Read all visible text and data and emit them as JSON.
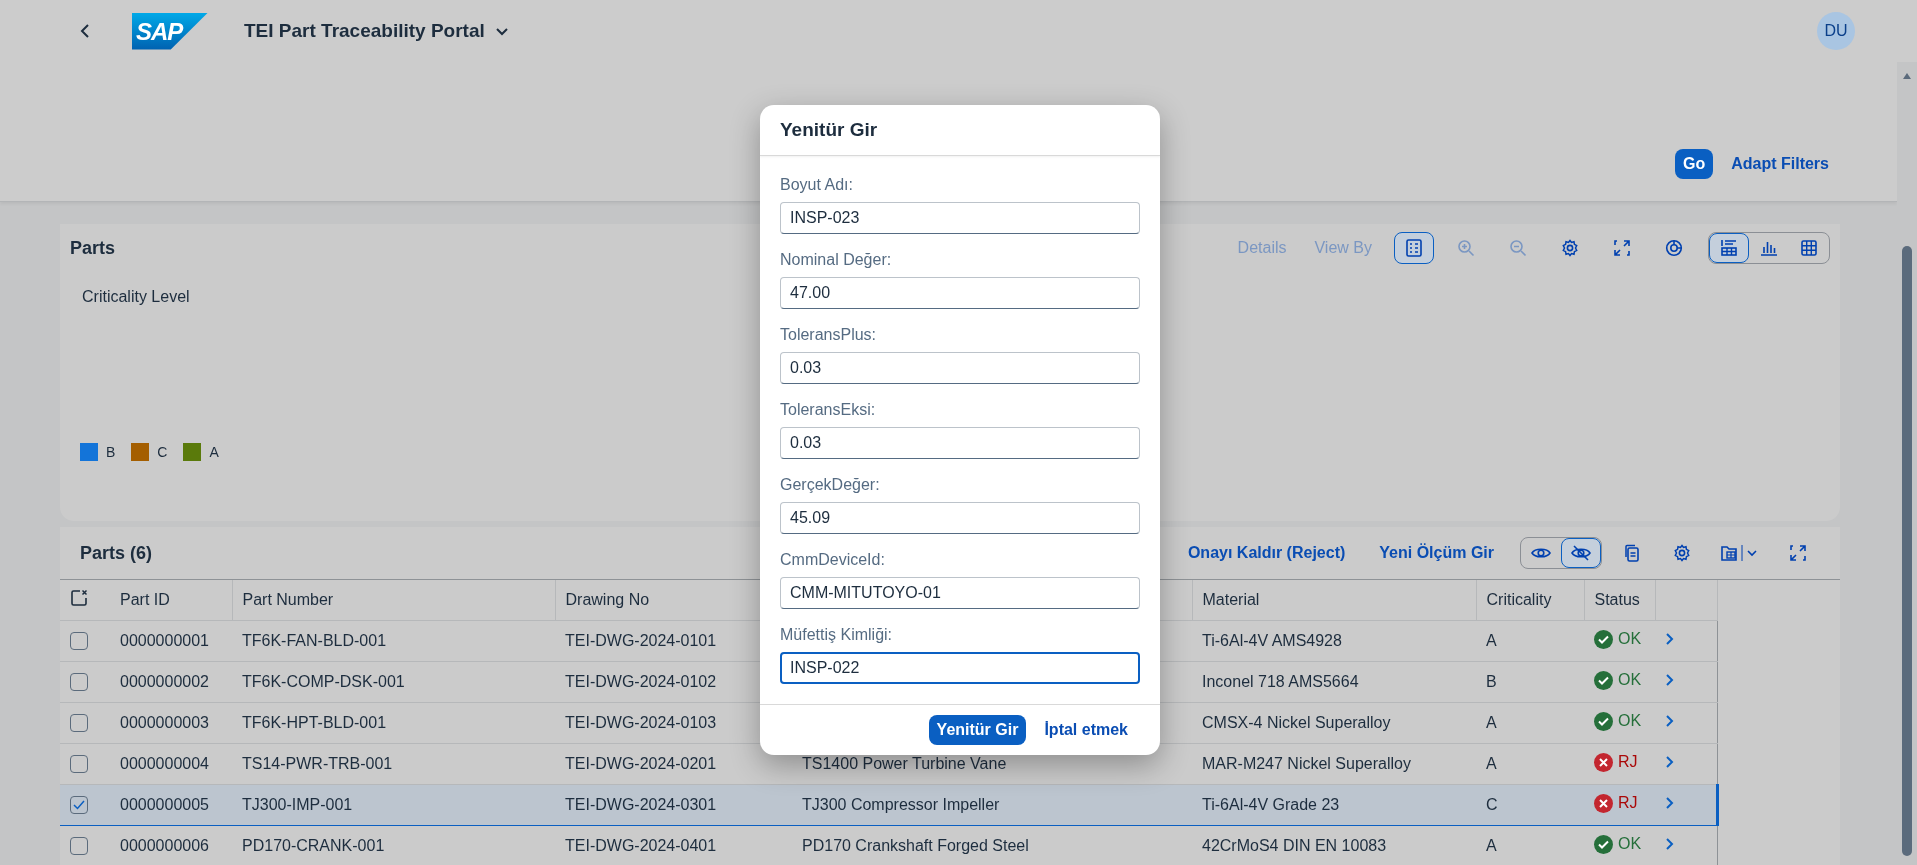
{
  "shell": {
    "logo": "SAP",
    "title": "TEI Part Traceability Portal",
    "avatar": "DU"
  },
  "filter_bar": {
    "buttons": [
      {
        "label": "Go",
        "kind": "emphasized"
      },
      {
        "label": "Adapt Filters",
        "kind": "transparent"
      }
    ]
  },
  "chart_panel": {
    "title": "Parts",
    "links": [
      {
        "label": "Details",
        "disabled": true
      },
      {
        "label": "View By",
        "disabled": true
      }
    ],
    "details_toggle": {
      "selected": true
    },
    "zoom_in": {
      "disabled": true
    },
    "zoom_out": {
      "disabled": true
    },
    "view_switch": [
      {
        "selected": true
      },
      {
        "selected": false
      },
      {
        "selected": false
      }
    ],
    "chart_title": "Criticality Level",
    "legend": [
      {
        "label": "B",
        "color": "#1374d9"
      },
      {
        "label": "C",
        "color": "#a45e00"
      },
      {
        "label": "A",
        "color": "#5a7a0b"
      }
    ]
  },
  "table": {
    "title": "Parts (6)",
    "actions": [
      "Onayı Kaldır (Reject)",
      "Yeni Ölçüm Gir"
    ],
    "visibility_toggle": [
      {
        "selected": false
      },
      {
        "selected": true
      }
    ],
    "columns": [
      "Part ID",
      "Part Number",
      "Drawing No",
      "Material",
      "Criticality",
      "Status"
    ],
    "rows": [
      {
        "selected": false,
        "part_id": "0000000001",
        "part_number": "TF6K-FAN-BLD-001",
        "drawing_no": "TEI-DWG-2024-0101",
        "material": "Ti-6Al-4V AMS4928",
        "criticality": "A",
        "status": {
          "text": "OK",
          "kind": "ok"
        }
      },
      {
        "selected": false,
        "part_id": "0000000002",
        "part_number": "TF6K-COMP-DSK-001",
        "drawing_no": "TEI-DWG-2024-0102",
        "material": "Inconel 718 AMS5664",
        "criticality": "B",
        "status": {
          "text": "OK",
          "kind": "ok"
        }
      },
      {
        "selected": false,
        "part_id": "0000000003",
        "part_number": "TF6K-HPT-BLD-001",
        "drawing_no": "TEI-DWG-2024-0103",
        "material": "CMSX-4 Nickel Superalloy",
        "criticality": "A",
        "status": {
          "text": "OK",
          "kind": "ok"
        }
      },
      {
        "selected": false,
        "part_id": "0000000004",
        "part_number": "TS14-PWR-TRB-001",
        "drawing_no": "TEI-DWG-2024-0201",
        "column_4": "TS1400 Power Turbine Vane",
        "material": "MAR-M247 Nickel Superalloy",
        "criticality": "A",
        "status": {
          "text": "RJ",
          "kind": "rejected"
        }
      },
      {
        "selected": true,
        "part_id": "0000000005",
        "part_number": "TJ300-IMP-001",
        "drawing_no": "TEI-DWG-2024-0301",
        "column_4": "TJ300 Compressor Impeller",
        "material": "Ti-6Al-4V Grade 23",
        "criticality": "C",
        "status": {
          "text": "RJ",
          "kind": "rejected"
        }
      },
      {
        "selected": false,
        "part_id": "0000000006",
        "part_number": "PD170-CRANK-001",
        "drawing_no": "TEI-DWG-2024-0401",
        "column_4": "PD170 Crankshaft Forged Steel",
        "material": "42CrMoS4 DIN EN 10083",
        "criticality": "A",
        "status": {
          "text": "OK",
          "kind": "ok"
        }
      }
    ]
  },
  "dialog": {
    "title": "Yenitür Gir",
    "fields": [
      {
        "label": "Boyut Adı:",
        "value": "INSP-023",
        "focused": false
      },
      {
        "label": "Nominal Değer:",
        "value": "47.00",
        "focused": false
      },
      {
        "label": "ToleransPlus:",
        "value": "0.03",
        "focused": false
      },
      {
        "label": "ToleransEksi:",
        "value": "0.03",
        "focused": false
      },
      {
        "label": "GerçekDeğer:",
        "value": "45.09",
        "focused": false
      },
      {
        "label": "CmmDeviceId:",
        "value": "CMM-MITUTOYO-01",
        "focused": false
      },
      {
        "label": "Müfettiş Kimliği:",
        "value": "INSP-022",
        "focused": true
      }
    ],
    "buttons": [
      {
        "label": "Yenitür Gir",
        "kind": "emphasized"
      },
      {
        "label": "İptal etmek",
        "kind": "transparent"
      }
    ]
  }
}
